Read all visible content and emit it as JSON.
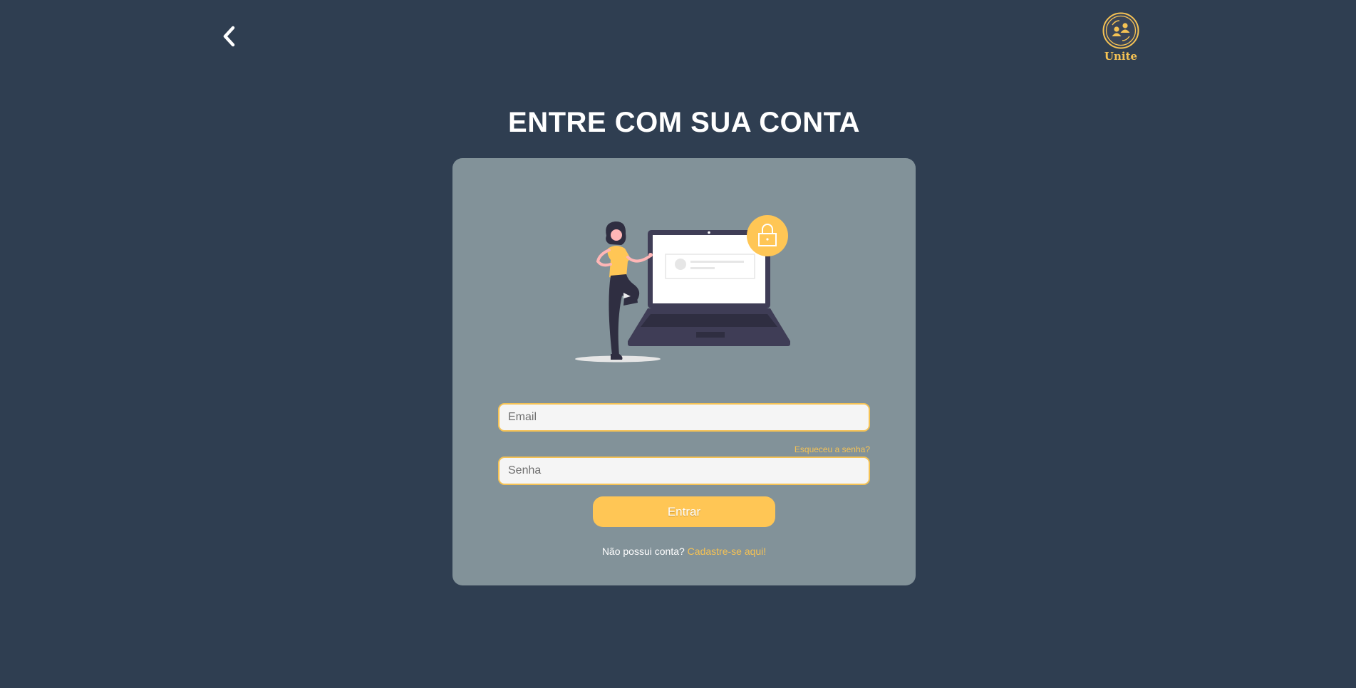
{
  "header": {
    "back_icon": "chevron-left-icon",
    "logo_text": "Unite",
    "logo_icon": "users-exchange-icon"
  },
  "main": {
    "title": "ENTRE COM SUA CONTA"
  },
  "form": {
    "email_placeholder": "Email",
    "email_value": "",
    "password_placeholder": "Senha",
    "password_value": "",
    "forgot_label": "Esqueceu a senha?",
    "submit_label": "Entrar",
    "no_account_text": "Não possui conta?",
    "signup_link": "Cadastre-se aqui!"
  },
  "colors": {
    "background": "#2f3e51",
    "card": "#829299",
    "accent": "#ffc655",
    "text": "#ffffff"
  }
}
